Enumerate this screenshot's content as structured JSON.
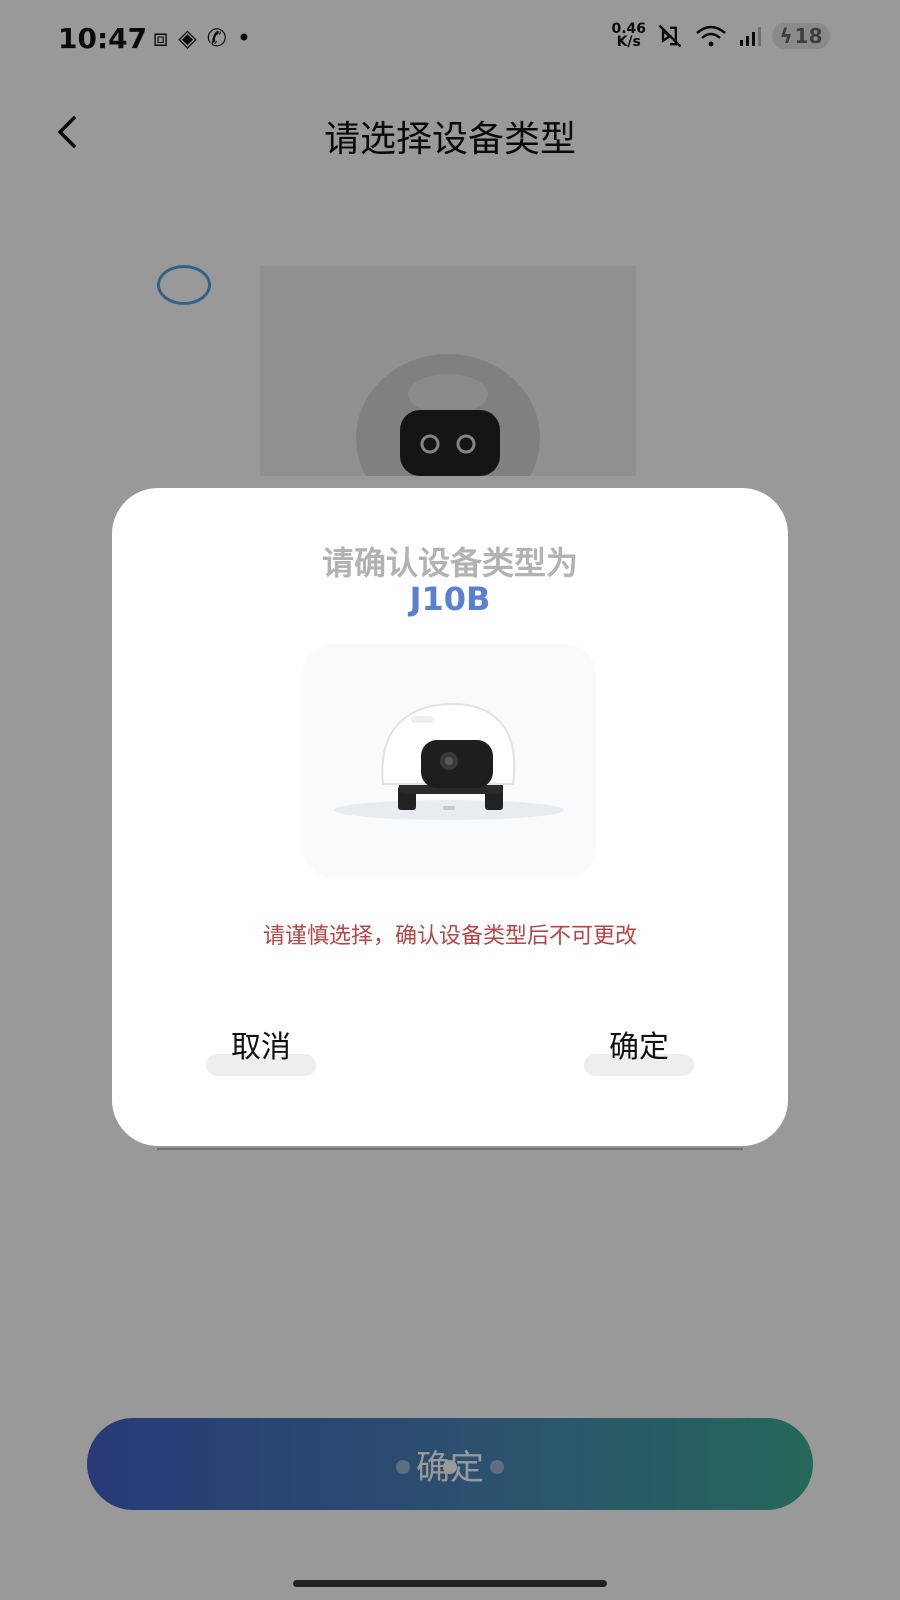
{
  "status_bar": {
    "time": "10:47",
    "net_speed_value": "0.46",
    "net_speed_unit": "K/s",
    "battery": "18"
  },
  "nav": {
    "title": "请选择设备类型"
  },
  "main": {
    "confirm_label": "确定",
    "page_dots_total": 3,
    "page_dots_active": 2
  },
  "dialog": {
    "title": "请确认设备类型为",
    "model": "J10B",
    "warning": "请谨慎选择，确认设备类型后不可更改",
    "cancel_label": "取消",
    "ok_label": "确定"
  },
  "colors": {
    "accent_blue": "#5a80d0",
    "warning_red": "#b84545",
    "gradient_start": "#4461c8",
    "gradient_end": "#3fae97"
  }
}
